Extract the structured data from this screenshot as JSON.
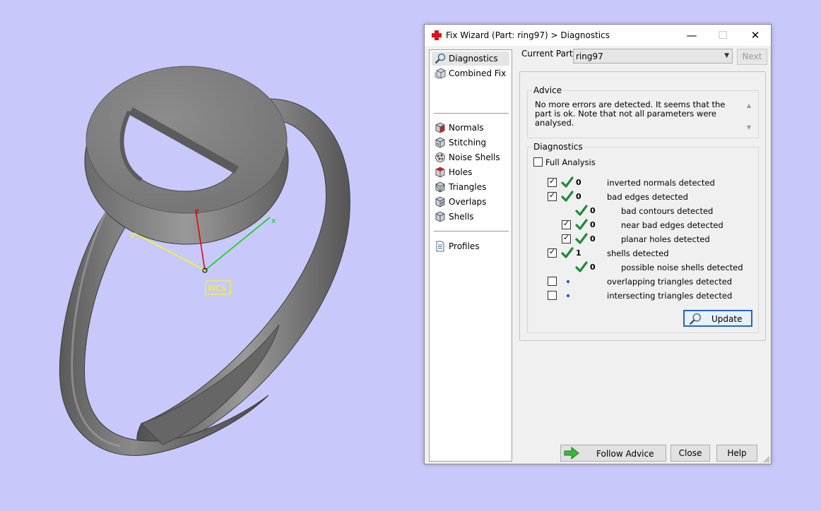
{
  "viewport": {
    "axis_x": "x",
    "axis_y": "y",
    "axis_z": "z",
    "wcs_label": "WCS"
  },
  "dialog": {
    "title": "Fix Wizard (Part: ring97) > Diagnostics",
    "current_part_label": "Current Part:",
    "current_part_value": "ring97",
    "next_label": "Next",
    "nav": [
      {
        "label": "Diagnostics",
        "icon": "magnifier-icon",
        "selected": true
      },
      {
        "label": "Combined Fix",
        "icon": "cube-stack-icon"
      },
      {
        "label": "Normals",
        "icon": "normals-cube-icon"
      },
      {
        "label": "Stitching",
        "icon": "stitching-cube-icon"
      },
      {
        "label": "Noise Shells",
        "icon": "noise-shells-icon"
      },
      {
        "label": "Holes",
        "icon": "holes-cube-icon"
      },
      {
        "label": "Triangles",
        "icon": "triangles-cube-icon"
      },
      {
        "label": "Overlaps",
        "icon": "overlaps-cube-icon"
      },
      {
        "label": "Shells",
        "icon": "shells-cube-icon"
      },
      {
        "label": "Profiles",
        "icon": "document-icon"
      }
    ],
    "advice_title": "Advice",
    "advice_text": "No more errors are detected. It seems that the part is ok. Note that not all parameters were analysed.",
    "diagnostics_title": "Diagnostics",
    "full_analysis_label": "Full Analysis",
    "full_analysis_checked": false,
    "rows": [
      {
        "checkbox": true,
        "checked": true,
        "status": "check",
        "count": "0",
        "label": "inverted normals detected",
        "indent": 0
      },
      {
        "checkbox": true,
        "checked": true,
        "status": "check",
        "count": "0",
        "label": "bad edges detected",
        "indent": 0
      },
      {
        "checkbox": false,
        "checked": false,
        "status": "check",
        "count": "0",
        "label": "bad contours detected",
        "indent": 1
      },
      {
        "checkbox": true,
        "checked": true,
        "status": "check",
        "count": "0",
        "label": "near bad edges detected",
        "indent": 1
      },
      {
        "checkbox": true,
        "checked": true,
        "status": "check",
        "count": "0",
        "label": "planar holes detected",
        "indent": 1
      },
      {
        "checkbox": true,
        "checked": true,
        "status": "check",
        "count": "1",
        "label": "shells detected",
        "indent": 0
      },
      {
        "checkbox": false,
        "checked": false,
        "status": "check",
        "count": "0",
        "label": "possible noise shells detected",
        "indent": 1
      },
      {
        "checkbox": true,
        "checked": false,
        "status": "dot",
        "count": "",
        "label": "overlapping triangles detected",
        "indent": 0
      },
      {
        "checkbox": true,
        "checked": false,
        "status": "dot",
        "count": "",
        "label": "intersecting triangles detected",
        "indent": 0
      }
    ],
    "update_label": "Update",
    "follow_advice_label": "Follow Advice",
    "close_label": "Close",
    "help_label": "Help"
  }
}
